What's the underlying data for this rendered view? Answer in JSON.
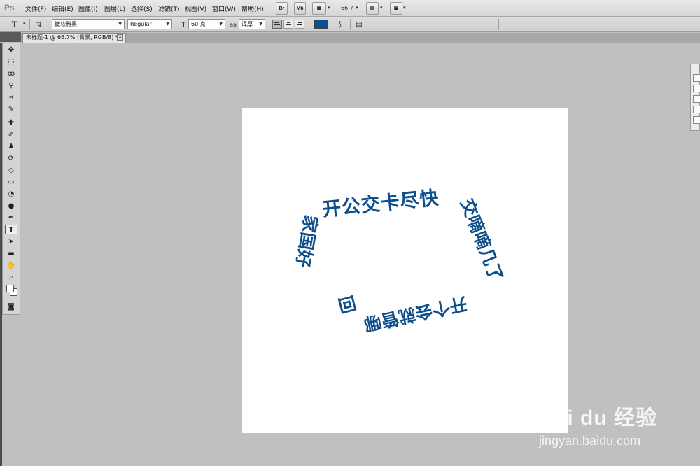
{
  "app": {
    "logo": "Ps"
  },
  "menu": {
    "items": [
      "文件(F)",
      "编辑(E)",
      "图像(I)",
      "图层(L)",
      "选择(S)",
      "滤镜(T)",
      "视图(V)",
      "窗口(W)",
      "帮助(H)"
    ],
    "bridge_label": "Br",
    "minibridge_label": "Mb",
    "zoom_value": "66.7"
  },
  "options": {
    "tool_glyph": "T",
    "font_family": "微软雅黑",
    "font_style": "Regular",
    "font_size": "60 点",
    "antialias": "浑厚",
    "text_color": "#0d4f8c"
  },
  "document": {
    "tab_title": "未标题-1 @ 66.7% (背景, RGB/8) *",
    "close_glyph": "×"
  },
  "canvas": {
    "text_color": "#0d4f8c",
    "lines": [
      {
        "text": "开公交卡尽快"
      },
      {
        "text": "交嘀嘀几了"
      },
      {
        "text": "开个会就管哪"
      },
      {
        "text": "回"
      },
      {
        "text": "家国好"
      }
    ]
  },
  "watermark": {
    "brand": "Bai du 经验",
    "url": "jingyan.baidu.com"
  }
}
